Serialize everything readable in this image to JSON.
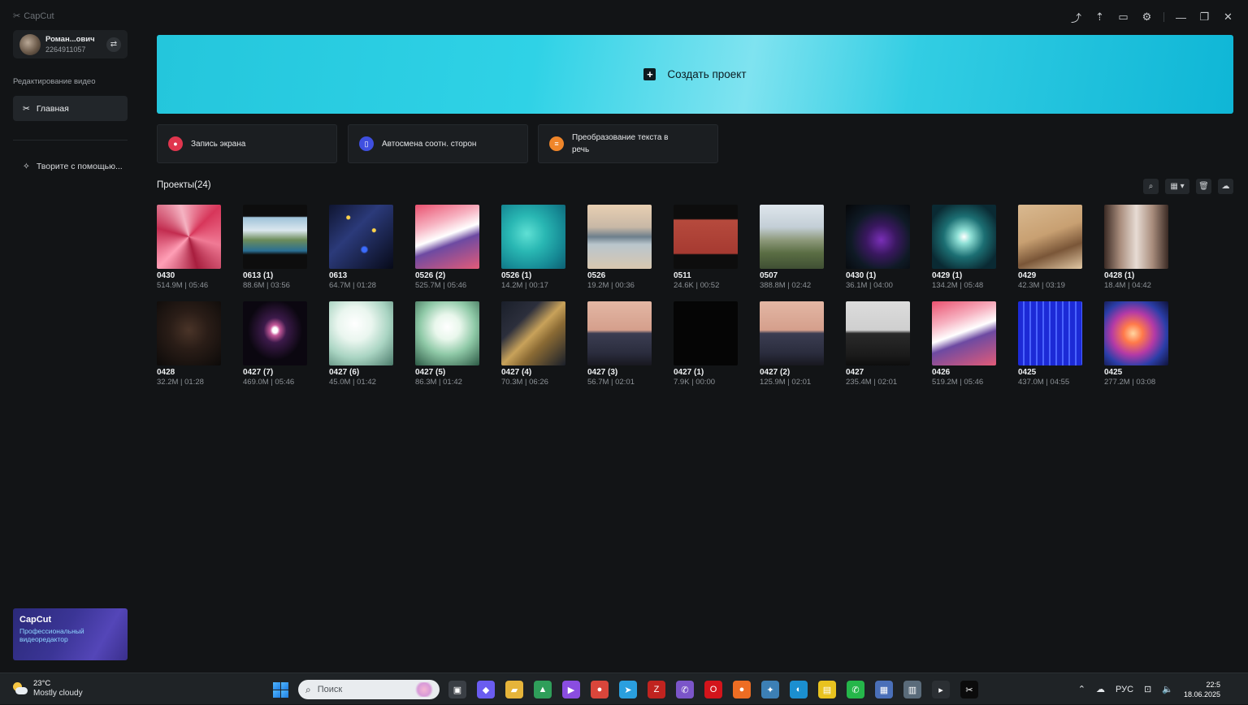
{
  "window": {
    "app_name": "CapCut",
    "controls": [
      {
        "name": "share-icon",
        "glyph": "⤴"
      },
      {
        "name": "upload-icon",
        "glyph": "⇡"
      },
      {
        "name": "feedback-icon",
        "glyph": "▭"
      },
      {
        "name": "settings-icon",
        "glyph": "⚙"
      },
      {
        "name": "minimize-icon",
        "glyph": "—"
      },
      {
        "name": "restore-icon",
        "glyph": "❐"
      },
      {
        "name": "close-icon",
        "glyph": "✕"
      }
    ]
  },
  "sidebar": {
    "user": {
      "name": "Роман...ович",
      "id": "2264911057"
    },
    "section_label": "Редактирование видео",
    "home_label": "Главная",
    "create_label": "Творите с помощью...",
    "promo": {
      "title": "CapCut",
      "subtitle": "Профессиональный видеоредактор"
    }
  },
  "banner": {
    "label": "Создать проект"
  },
  "features": [
    {
      "label": "Запись экрана",
      "icon": "record-icon",
      "color": "#e0364e"
    },
    {
      "label": "Автосмена соотн. сторон",
      "icon": "aspect-ratio-icon",
      "color": "#3f4fe0"
    },
    {
      "label": "Преобразование текста в речь",
      "icon": "text-to-speech-icon",
      "color": "#f0862a"
    }
  ],
  "projects": {
    "title": "Проекты",
    "count": "(24)",
    "items": [
      {
        "name": "0430",
        "meta": "514.9M | 05:46",
        "thumb": "t-red"
      },
      {
        "name": "0613 (1)",
        "meta": "88.6M | 03:56",
        "thumb": "t-sea-rock"
      },
      {
        "name": "0613",
        "meta": "64.7M | 01:28",
        "thumb": "t-space-dots"
      },
      {
        "name": "0526 (2)",
        "meta": "525.7M | 05:46",
        "thumb": "t-red2"
      },
      {
        "name": "0526 (1)",
        "meta": "14.2M | 00:17",
        "thumb": "t-lagoon"
      },
      {
        "name": "0526",
        "meta": "19.2M | 00:36",
        "thumb": "t-beach"
      },
      {
        "name": "0511",
        "meta": "24.6K | 00:52",
        "thumb": "t-title"
      },
      {
        "name": "0507",
        "meta": "388.8M | 02:42",
        "thumb": "t-valley"
      },
      {
        "name": "0430 (1)",
        "meta": "36.1M | 04:00",
        "thumb": "t-nebula-dark"
      },
      {
        "name": "0429 (1)",
        "meta": "134.2M | 05:48",
        "thumb": "t-tunnel"
      },
      {
        "name": "0429",
        "meta": "42.3M | 03:19",
        "thumb": "t-puppets"
      },
      {
        "name": "0428 (1)",
        "meta": "18.4M | 04:42",
        "thumb": "t-faces"
      },
      {
        "name": "0428",
        "meta": "32.2M | 01:28",
        "thumb": "t-dark-room"
      },
      {
        "name": "0427 (7)",
        "meta": "469.0M | 05:46",
        "thumb": "t-warp"
      },
      {
        "name": "0427 (6)",
        "meta": "45.0M | 01:42",
        "thumb": "t-bright"
      },
      {
        "name": "0427 (5)",
        "meta": "86.3M | 01:42",
        "thumb": "t-bright2"
      },
      {
        "name": "0427 (4)",
        "meta": "70.3M | 06:26",
        "thumb": "t-guitar"
      },
      {
        "name": "0427 (3)",
        "meta": "56.7M | 02:01",
        "thumb": "t-train"
      },
      {
        "name": "0427 (1)",
        "meta": "7.9K | 00:00",
        "thumb": "t-black"
      },
      {
        "name": "0427 (2)",
        "meta": "125.9M | 02:01",
        "thumb": "t-train"
      },
      {
        "name": "0427",
        "meta": "235.4M | 02:01",
        "thumb": "t-train2"
      },
      {
        "name": "0426",
        "meta": "519.2M | 05:46",
        "thumb": "t-red2"
      },
      {
        "name": "0425",
        "meta": "437.0M | 04:55",
        "thumb": "t-blue-grid"
      },
      {
        "name": "0425",
        "meta": "277.2M | 03:08",
        "thumb": "t-cosmos"
      }
    ]
  },
  "taskbar": {
    "weather": {
      "temp": "23°C",
      "condition": "Mostly cloudy"
    },
    "search_placeholder": "Поиск",
    "apps": [
      {
        "name": "task-view-icon",
        "glyph": "▣",
        "color": "#3a3f45"
      },
      {
        "name": "copilot-icon",
        "glyph": "◆",
        "color": "#6a5cf0"
      },
      {
        "name": "file-explorer-icon",
        "glyph": "▰",
        "color": "#e6b43a"
      },
      {
        "name": "photos-icon",
        "glyph": "▲",
        "color": "#2f9e5a"
      },
      {
        "name": "media-player-icon",
        "glyph": "▶",
        "color": "#8a4de0"
      },
      {
        "name": "chrome-icon",
        "glyph": "●",
        "color": "#d9463b"
      },
      {
        "name": "telegram-icon",
        "glyph": "➤",
        "color": "#2a9fde"
      },
      {
        "name": "filezilla-icon",
        "glyph": "Z",
        "color": "#c0231f"
      },
      {
        "name": "viber-icon",
        "glyph": "✆",
        "color": "#7b55c9"
      },
      {
        "name": "opera-icon",
        "glyph": "O",
        "color": "#d3141b"
      },
      {
        "name": "firefox-icon",
        "glyph": "●",
        "color": "#ee6d23"
      },
      {
        "name": "tool-icon",
        "glyph": "✦",
        "color": "#3c7fb5"
      },
      {
        "name": "edge-icon",
        "glyph": "◐",
        "color": "#1b8fd0"
      },
      {
        "name": "sticky-notes-icon",
        "glyph": "▤",
        "color": "#e8c21f"
      },
      {
        "name": "whatsapp-icon",
        "glyph": "✆",
        "color": "#25b64a"
      },
      {
        "name": "store-icon",
        "glyph": "▦",
        "color": "#4a6fb8"
      },
      {
        "name": "lock-app-icon",
        "glyph": "▥",
        "color": "#5a6b7a"
      },
      {
        "name": "terminal-icon",
        "glyph": "▸",
        "color": "#2b2f33"
      },
      {
        "name": "capcut-taskbar-icon",
        "glyph": "✂",
        "color": "#0b0b0b"
      }
    ],
    "tray": {
      "lang": "РУС",
      "time": "22:5",
      "date": "18.06.2025"
    }
  }
}
